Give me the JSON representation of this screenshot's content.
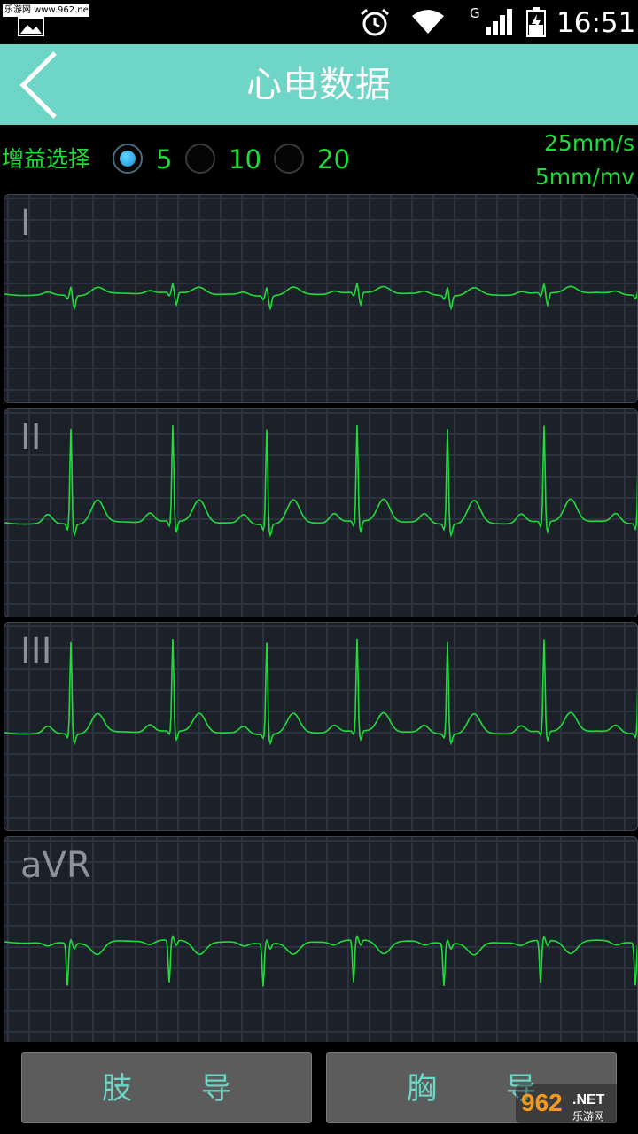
{
  "status_bar": {
    "watermark_text": "乐游网 www.962.net",
    "network": "G",
    "time": "16:51",
    "icons": [
      "image-icon",
      "alarm-icon",
      "wifi-icon",
      "signal-icon",
      "battery-charging-icon"
    ]
  },
  "header": {
    "title": "心电数据",
    "back_icon": "chevron-left-icon"
  },
  "gain": {
    "label": "增益选择",
    "options": [
      "5",
      "10",
      "20"
    ],
    "selected": "5",
    "paper_speed": "25mm/s",
    "sensitivity": "5mm/mv"
  },
  "leads": [
    {
      "label": "I"
    },
    {
      "label": "II"
    },
    {
      "label": "III"
    },
    {
      "label": "aVR"
    }
  ],
  "trace_color": "#1fdc3a",
  "accent_color": "#6fd5c6",
  "bottom": {
    "limb_button": "肢导",
    "chest_button": "胸导"
  },
  "corner_watermark": {
    "brand": "962",
    "suffix": ".NET",
    "sub": "乐游网"
  }
}
